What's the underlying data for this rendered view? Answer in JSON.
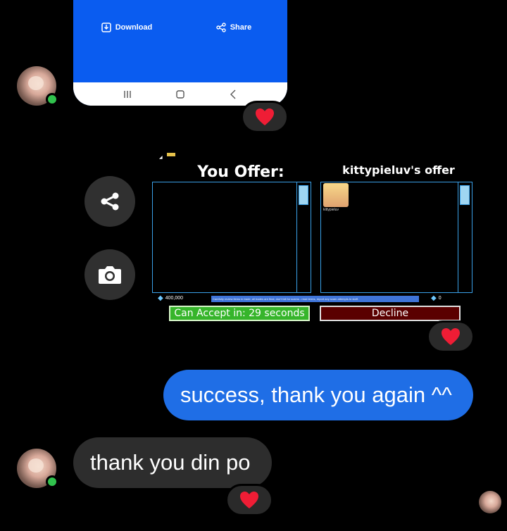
{
  "shared_screenshot": {
    "download_label": "Download",
    "share_label": "Share",
    "accent_color": "#0a5cf0"
  },
  "side_actions": {
    "share_icon": "share-icon",
    "camera_icon": "camera-icon"
  },
  "trade": {
    "your_offer_title": "You Offer:",
    "their_offer_title": "kittypieluv's offer",
    "your_diamonds": "400,000",
    "their_diamonds": "0",
    "notice_text": "Carefully review items in trade, all trades are final, don't fall for scams - read terms, report any scam attempts to staff.",
    "accept_label": "Can Accept in: 29 seconds",
    "decline_label": "Decline",
    "offer_item_label": "kittypieluv",
    "accept_color": "#36b52b",
    "decline_color": "#5a0000"
  },
  "messages": [
    {
      "direction": "outgoing",
      "text": "success, thank you again ^^"
    },
    {
      "direction": "incoming",
      "text": "thank you din po"
    }
  ],
  "reactions": [
    "heart",
    "heart",
    "heart"
  ],
  "colors": {
    "outgoing_bubble": "#1f6ee6",
    "incoming_bubble": "#2d2d2d",
    "online": "#31c24d"
  }
}
